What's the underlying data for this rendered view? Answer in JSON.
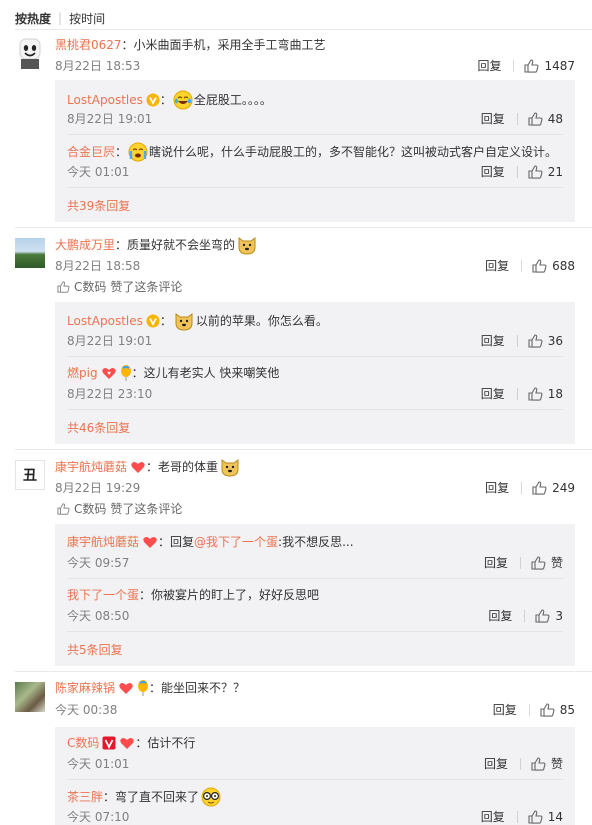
{
  "sort": {
    "hot": "按热度",
    "time": "按时间"
  },
  "common": {
    "reply": "回复",
    "liked_by_sep": "赞了这条评论"
  },
  "comments": [
    {
      "user": "黑桃君0627",
      "text": "：小米曲面手机，采用全手工弯曲工艺",
      "date": "8月22日 18:53",
      "likes": "1487",
      "replies": [
        {
          "user": "LostApostles",
          "text": "全屁股工。。。。",
          "date": "8月22日 19:01",
          "likes": "48"
        },
        {
          "user": "合金巨屄",
          "text": "瞎说什么呢，什么手动屁股工的，多不智能化？这叫被动式客户自定义设计。",
          "date": "今天 01:01",
          "likes": "21"
        }
      ],
      "more": "共39条回复"
    },
    {
      "user": "大鹏成万里",
      "text": "：质量好就不会坐弯的",
      "date": "8月22日 18:58",
      "likes": "688",
      "liked_user": "C数码",
      "liked_text": "赞了这条评论",
      "replies": [
        {
          "user": "LostApostles",
          "text": "以前的苹果。你怎么看。",
          "date": "8月22日 19:01",
          "likes": "36"
        },
        {
          "user": "燃pig",
          "text": "：这儿有老实人 快来嘲笑他",
          "date": "8月22日 23:10",
          "likes": "18"
        }
      ],
      "more": "共46条回复"
    },
    {
      "user": "康宇航炖蘑菇",
      "text": "：老哥的体重",
      "date": "8月22日 19:29",
      "likes": "249",
      "avatar_text": "丑",
      "liked_user": "C数码",
      "liked_text": "赞了这条评论",
      "replies": [
        {
          "user": "康宇航炖蘑菇",
          "text_prefix": "：回复",
          "mention": "@我下了一个蛋",
          "text": ":我不想反思...",
          "date": "今天 09:57",
          "likes": "赞"
        },
        {
          "user": "我下了一个蛋",
          "text": "：你被宴片的盯上了，好好反思吧",
          "date": "今天 08:50",
          "likes": "3"
        }
      ],
      "more": "共5条回复"
    },
    {
      "user": "陈家麻辣锅",
      "text": "：能坐回来不？？",
      "date": "今天 00:38",
      "likes": "85",
      "replies": [
        {
          "user": "C数码",
          "text": "：估计不行",
          "date": "今天 01:01",
          "likes": "赞"
        },
        {
          "user": "茶三胖",
          "text": "：弯了直不回来了",
          "date": "今天 07:10",
          "likes": "14"
        }
      ]
    }
  ]
}
